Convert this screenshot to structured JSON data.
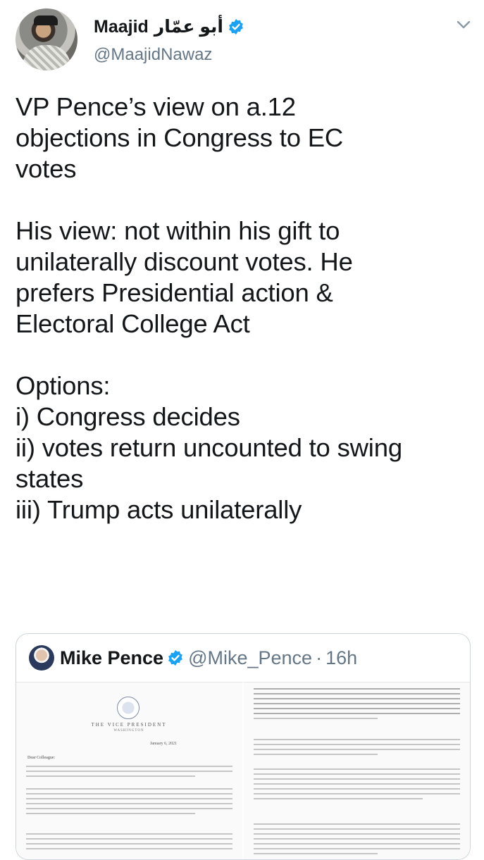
{
  "author": {
    "name": "Maajid",
    "name_arabic": "أبو عمّار",
    "handle": "@MaajidNawaz",
    "avatar_icon": "profile-photo",
    "verified_icon": "verified-badge-icon"
  },
  "tweet": {
    "text": "VP Pence’s view on a.12\nobjections in Congress to EC\nvotes\n\nHis view: not within his gift to\nunilaterally discount votes. He\nprefers Presidential action &\nElectoral College Act\n\nOptions:\ni) Congress decides\nii) votes return uncounted to swing\nstates\niii) Trump acts unilaterally"
  },
  "quoted": {
    "name": "Mike Pence",
    "handle": "@Mike_Pence",
    "separator": "·",
    "time": "16h",
    "doc_left": {
      "title": "THE VICE PRESIDENT",
      "subtitle": "WASHINGTON",
      "date": "January 6, 2021",
      "salutation": "Dear Colleague:"
    }
  },
  "colors": {
    "text": "#14171a",
    "secondary": "#657786",
    "verified": "#1da1f2",
    "border": "#ccd6dd"
  }
}
